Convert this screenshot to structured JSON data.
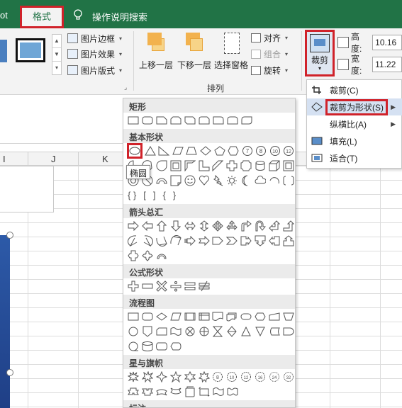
{
  "tabs": {
    "prev_tab": "ot",
    "format_tab": "格式",
    "tell_me": "操作说明搜索"
  },
  "picture_styles": {
    "border": "图片边框",
    "effects": "图片效果",
    "layout": "图片版式"
  },
  "arrange": {
    "bring_forward": "上移一层",
    "send_backward": "下移一层",
    "selection_pane": "选择窗格",
    "align": "对齐",
    "group": "组合",
    "rotate": "旋转",
    "group_label": "排列"
  },
  "size": {
    "crop_button": "裁剪",
    "height_label": "高度:",
    "height_value": "10.16",
    "width_label": "宽度:",
    "width_value": "11.22"
  },
  "crop_menu": {
    "items": [
      {
        "label": "裁剪(C)",
        "has_submenu": false,
        "icon": "crop-icon"
      },
      {
        "label": "裁剪为形状(S)",
        "has_submenu": true,
        "icon": "crop-to-shape-icon",
        "active": true
      },
      {
        "label": "纵横比(A)",
        "has_submenu": true,
        "icon": ""
      },
      {
        "label": "填充(L)",
        "has_submenu": false,
        "icon": "fill-icon"
      },
      {
        "label": "适合(T)",
        "has_submenu": false,
        "icon": "fit-icon"
      }
    ]
  },
  "shapes_gallery": {
    "sections": {
      "rectangles": "矩形",
      "basic": "基本形状",
      "arrows": "箭头总汇",
      "equation": "公式形状",
      "flowchart": "流程图",
      "stars": "星与旗帜",
      "callouts": "标注"
    },
    "tooltip": "椭圆",
    "number_labels": [
      "7",
      "8",
      "10",
      "12"
    ],
    "braces": [
      "{ }",
      "[",
      "]",
      "{",
      "}"
    ]
  },
  "sheet": {
    "columns": [
      "I",
      "J",
      "K"
    ]
  },
  "colors": {
    "ribbon_green": "#217346",
    "highlight_red": "#d0222a",
    "active_blue": "#d5e1f2"
  }
}
